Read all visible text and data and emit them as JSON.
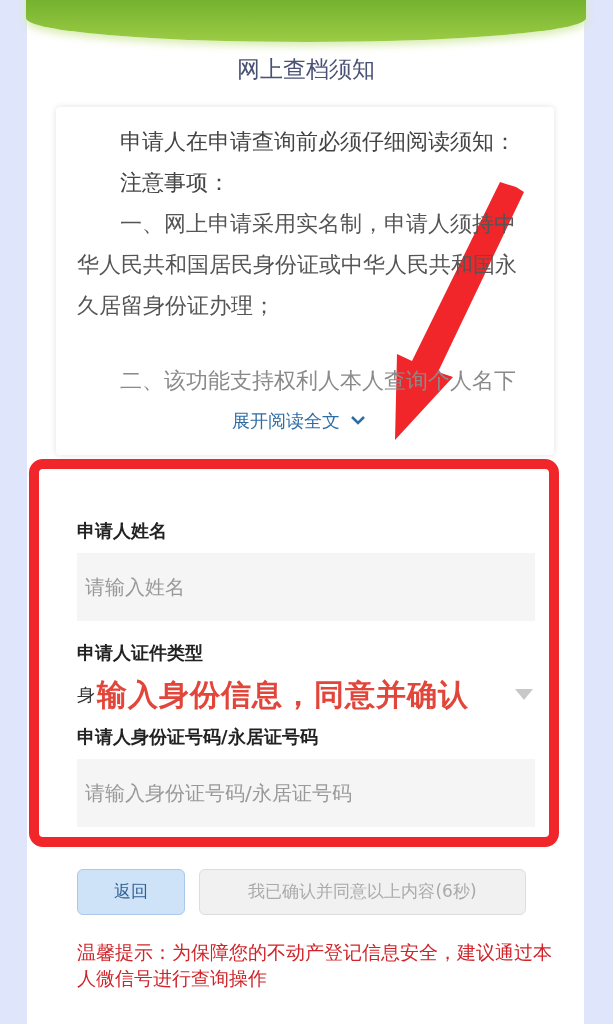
{
  "header": {
    "title": "网上查档须知"
  },
  "notice": {
    "paragraphs": [
      "申请人在申请查询前必须仔细阅读须知：",
      "注意事项：",
      "一、网上申请采用实名制，申请人须持中华人民共和国居民身份证或中华人民共和国永久居留身份证办理；",
      "二、该功能支持权利人本人查询个人名下"
    ],
    "expand_link": "展开阅读全文"
  },
  "form": {
    "fields": [
      {
        "kind": "text",
        "label": "申请人姓名",
        "placeholder": "请输入姓名"
      },
      {
        "kind": "select",
        "label": "申请人证件类型",
        "value": "身"
      },
      {
        "kind": "text",
        "label": "申请人身份证号码/永居证号码",
        "placeholder": "请输入身份证号码/永居证号码"
      }
    ]
  },
  "annotation": {
    "text": "输入身份信息，同意并确认"
  },
  "buttons": [
    {
      "label": "返回",
      "disabled": false
    },
    {
      "label": "我已确认并同意以上内容(6秒)",
      "disabled": true
    }
  ],
  "warning": "温馨提示：为保障您的不动产登记信息安全，建议通过本人微信号进行查询操作"
}
